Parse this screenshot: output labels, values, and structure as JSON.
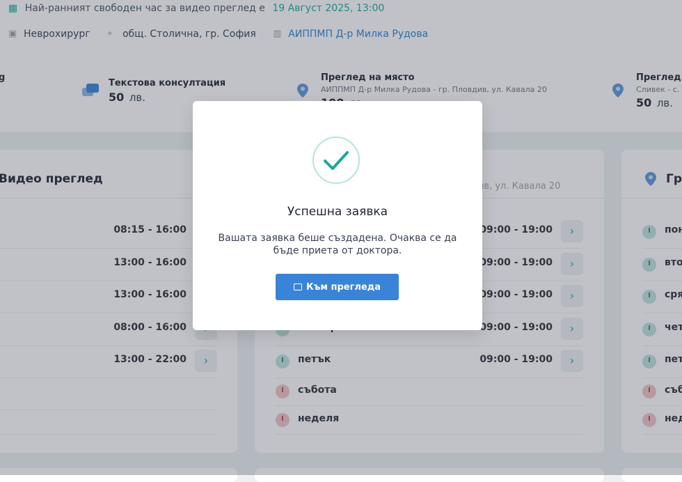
{
  "top": {
    "earliest_label": "Най-ранният свободен час за видео преглед е",
    "earliest_datetime": "19 Август 2025, 13:00",
    "specialty": "Неврохирург",
    "location": "общ. Столична, гр. София",
    "practice": "АИППМП Д-р Милка Рудова"
  },
  "services": [
    {
      "title": "g",
      "addr": "",
      "price": "",
      "currency": ""
    },
    {
      "title": "Текстова консултация",
      "addr": "",
      "price": "50",
      "currency": "лв."
    },
    {
      "title": "Преглед на място",
      "addr": "АИППМП Д-р Милка Рудова - гр. Пловдив, ул. Кавала 20",
      "price": "100",
      "currency": "лв."
    },
    {
      "title": "Преглед н",
      "addr": "Сливек - с. С",
      "price": "50",
      "currency": "лв."
    }
  ],
  "cards": {
    "left": {
      "title": "Видео преглед",
      "rows": [
        {
          "time": "08:15 - 16:00"
        },
        {
          "time": "13:00 - 16:00"
        },
        {
          "time": "13:00 - 16:00"
        },
        {
          "time": "08:00 - 16:00"
        },
        {
          "time": "13:00 - 22:00"
        }
      ]
    },
    "middle": {
      "subtitle": "див, ул. Кавала 20",
      "rows": [
        {
          "day": "",
          "time": "09:00 - 19:00",
          "status": "open"
        },
        {
          "day": "",
          "time": "09:00 - 19:00",
          "status": "open"
        },
        {
          "day": "",
          "time": "09:00 - 19:00",
          "status": "open"
        },
        {
          "day": "четвъртък",
          "time": "09:00 - 19:00",
          "status": "open"
        },
        {
          "day": "петък",
          "time": "09:00 - 19:00",
          "status": "open"
        },
        {
          "day": "събота",
          "time": "",
          "status": "closed"
        },
        {
          "day": "неделя",
          "time": "",
          "status": "closed"
        }
      ]
    },
    "right": {
      "title": "Гр",
      "rows": [
        {
          "day": "пон",
          "status": "open"
        },
        {
          "day": "вто",
          "status": "open"
        },
        {
          "day": "сря",
          "status": "open"
        },
        {
          "day": "чет",
          "status": "open"
        },
        {
          "day": "пет",
          "status": "open"
        },
        {
          "day": "съб",
          "status": "closed"
        },
        {
          "day": "нед",
          "status": "closed"
        }
      ]
    }
  },
  "modal": {
    "title": "Успешна заявка",
    "message": "Вашата заявка беше създадена. Очаква се да бъде приета от доктора.",
    "button": "Към прегледа"
  },
  "colors": {
    "accent": "#1aa89a",
    "primary": "#3a84d8",
    "link": "#2f80d1"
  }
}
